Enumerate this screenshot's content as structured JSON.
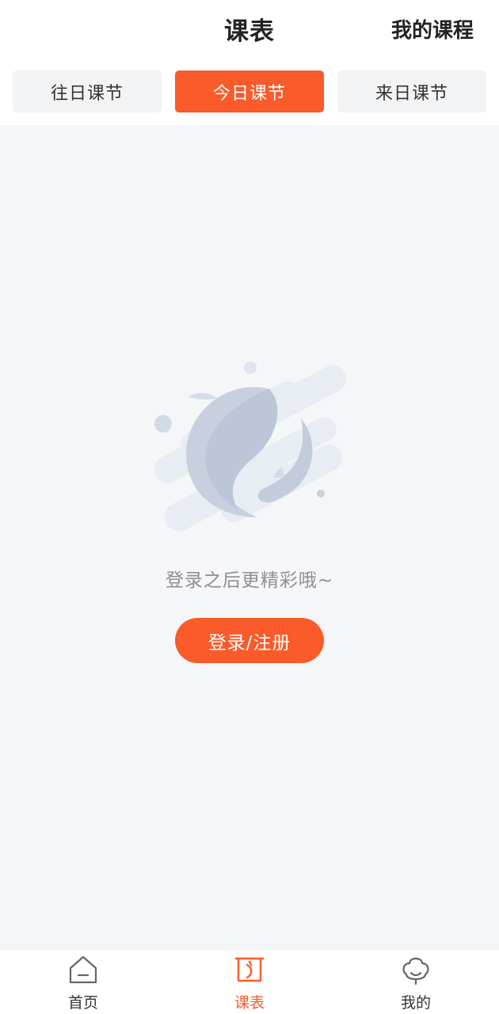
{
  "header": {
    "title": "课表",
    "my_courses_label": "我的课程"
  },
  "tabs": [
    {
      "label": "往日课节",
      "active": false
    },
    {
      "label": "今日课节",
      "active": true
    },
    {
      "label": "来日课节",
      "active": false
    }
  ],
  "empty_state": {
    "illustration_icon": "koi-fish-illustration",
    "message": "登录之后更精彩哦~",
    "login_button_label": "登录/注册"
  },
  "bottom_nav": {
    "items": [
      {
        "label": "首页",
        "icon": "home-icon",
        "active": false
      },
      {
        "label": "课表",
        "icon": "schedule-icon",
        "active": true
      },
      {
        "label": "我的",
        "icon": "profile-icon",
        "active": false
      }
    ]
  },
  "colors": {
    "accent": "#fb5a2a",
    "background": "#f5f6f8",
    "tab_inactive": "#f2f3f5",
    "muted_text": "#8e8e93"
  }
}
